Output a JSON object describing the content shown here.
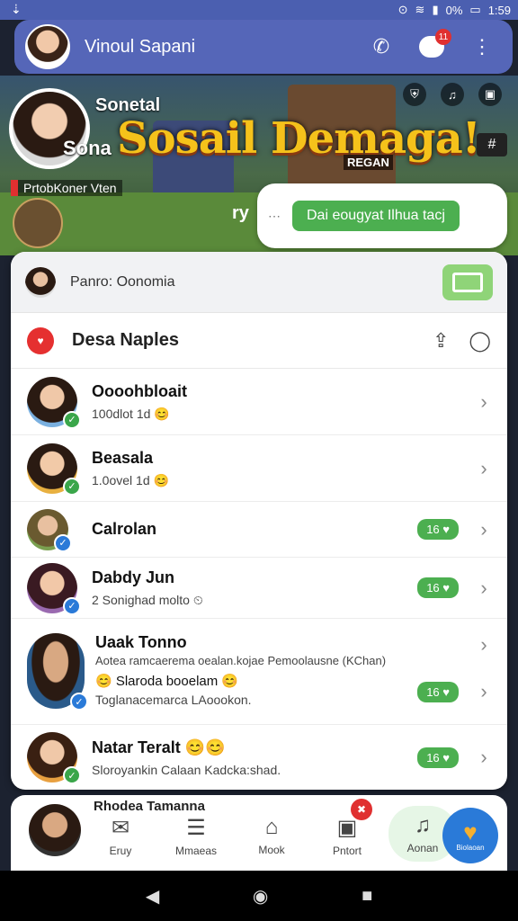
{
  "status_bar": {
    "time": "1:59",
    "battery_pct": "0%",
    "left_icon": "download-icon"
  },
  "app_bar": {
    "title": "Vinoul Sapani",
    "notification_badge": "11"
  },
  "banner": {
    "name_top": "Sonetal",
    "name_side": "Sona",
    "logo_text": "Sosail Demaga!",
    "logo_sub": "REGAN",
    "tag_text": "PrtobKoner Vten",
    "pin_text": "ry",
    "hash_text": "#"
  },
  "bubble": {
    "dots": "⋯",
    "label": "Dai eougyat Ilhua tacj"
  },
  "search": {
    "placeholder": "Panro: Oonomia"
  },
  "section": {
    "title": "Desa Naples"
  },
  "contacts": [
    {
      "name": "Oooohbloait",
      "sub": "100dlot 1d 😊",
      "pill": "",
      "check_color": "#3aa64a"
    },
    {
      "name": "Beasala",
      "sub": "1.0ovel 1d 😊",
      "pill": "",
      "check_color": "#3aa64a"
    },
    {
      "name": "Calrolan",
      "sub": "",
      "pill": "16 ♥",
      "check_color": "#2a7ad8"
    },
    {
      "name": "Dabdy Jun",
      "sub": "2 Sonighad molto ⏲",
      "pill": "16 ♥",
      "check_color": "#2a7ad8"
    },
    {
      "name": "Uaak Tonno",
      "sub": "Aotea ramcaerema oealan.kojae Pemoolausne (KChan)",
      "sub2": "😊 Slaroda booelam 😊",
      "sub3": "Toglanacemarca LAoookon.",
      "pill": "16 ♥",
      "check_color": "#2a7ad8"
    },
    {
      "name": "Natar Teralt 😊😊",
      "sub": "Sloroyankin Calaan Kadcka:shad.",
      "pill": "16 ♥",
      "check_color": "#3aa64a"
    }
  ],
  "bottom_nav": {
    "peek_name": "Rhodea Tamanna",
    "tabs": [
      {
        "label": "Eruy",
        "icon": "✉"
      },
      {
        "label": "Mmaeas",
        "icon": "☰"
      },
      {
        "label": "Mook",
        "icon": "⌂"
      },
      {
        "label": "Pntort",
        "icon": "▣",
        "badge": "✖"
      },
      {
        "label": "Aonan",
        "icon": "♫"
      }
    ],
    "fab_label": "Biolaoan"
  },
  "colors": {
    "primary": "#5566b8",
    "accent_green": "#4caf50",
    "badge_red": "#e03030"
  }
}
